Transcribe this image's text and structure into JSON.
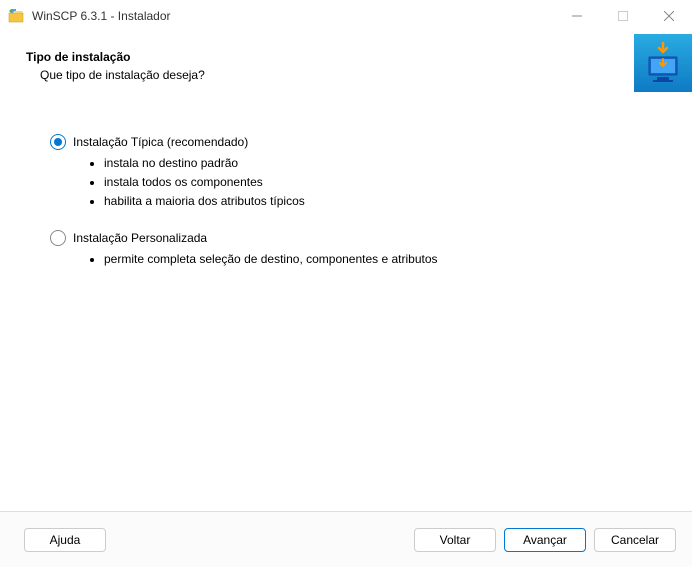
{
  "window": {
    "title": "WinSCP 6.3.1 - Instalador"
  },
  "page": {
    "title": "Tipo de instalação",
    "subtitle": "Que tipo de instalação deseja?"
  },
  "options": {
    "typical": {
      "label": "Instalação Típica (recomendado)",
      "selected": true,
      "bullets": [
        "instala no destino padrão",
        "instala todos os componentes",
        "habilita a maioria dos atributos típicos"
      ]
    },
    "custom": {
      "label": "Instalação Personalizada",
      "selected": false,
      "bullets": [
        "permite completa seleção de destino, componentes e atributos"
      ]
    }
  },
  "footer": {
    "help": "Ajuda",
    "back": "Voltar",
    "next": "Avançar",
    "cancel": "Cancelar"
  }
}
